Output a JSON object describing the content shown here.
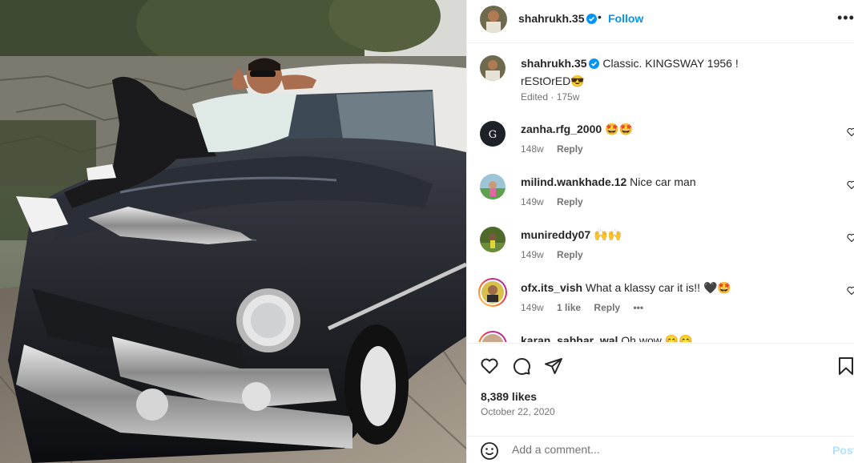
{
  "colors": {
    "accent": "#0095f6",
    "verified": "#0095f6",
    "text": "#262626",
    "muted": "#737373"
  },
  "post": {
    "author": "shahrukh.35",
    "follow_label": "Follow",
    "separator": "•",
    "more_label": "•••",
    "caption": {
      "username": "shahrukh.35",
      "text": "Classic. KINGSWAY 1956 !",
      "text_line2": "rEStOrED😎",
      "edited": "Edited · 175w"
    },
    "comments": [
      {
        "username": "zanha.rfg_2000",
        "text": "🤩🤩",
        "age": "148w",
        "likes": "",
        "reply": "Reply"
      },
      {
        "username": "milind.wankhade.12",
        "text": "Nice car man",
        "age": "149w",
        "likes": "",
        "reply": "Reply"
      },
      {
        "username": "munireddy07",
        "text": "🙌🙌",
        "age": "149w",
        "likes": "",
        "reply": "Reply"
      },
      {
        "username": "ofx.its_vish",
        "text": "What a klassy car it is!! 🖤🤩",
        "age": "149w",
        "likes": "1 like",
        "reply": "Reply",
        "more": "•••"
      },
      {
        "username": "karan_sabhar_wal",
        "text": "Oh wow 😊😊"
      }
    ],
    "likes": "8,389 likes",
    "date": "October 22, 2020",
    "add_comment_placeholder": "Add a comment...",
    "post_label": "Post"
  },
  "icons": {
    "heart": "heart-icon",
    "comment": "comment-icon",
    "share": "share-icon",
    "save": "bookmark-icon",
    "emoji": "emoji-icon",
    "verified": "verified-badge-icon"
  }
}
